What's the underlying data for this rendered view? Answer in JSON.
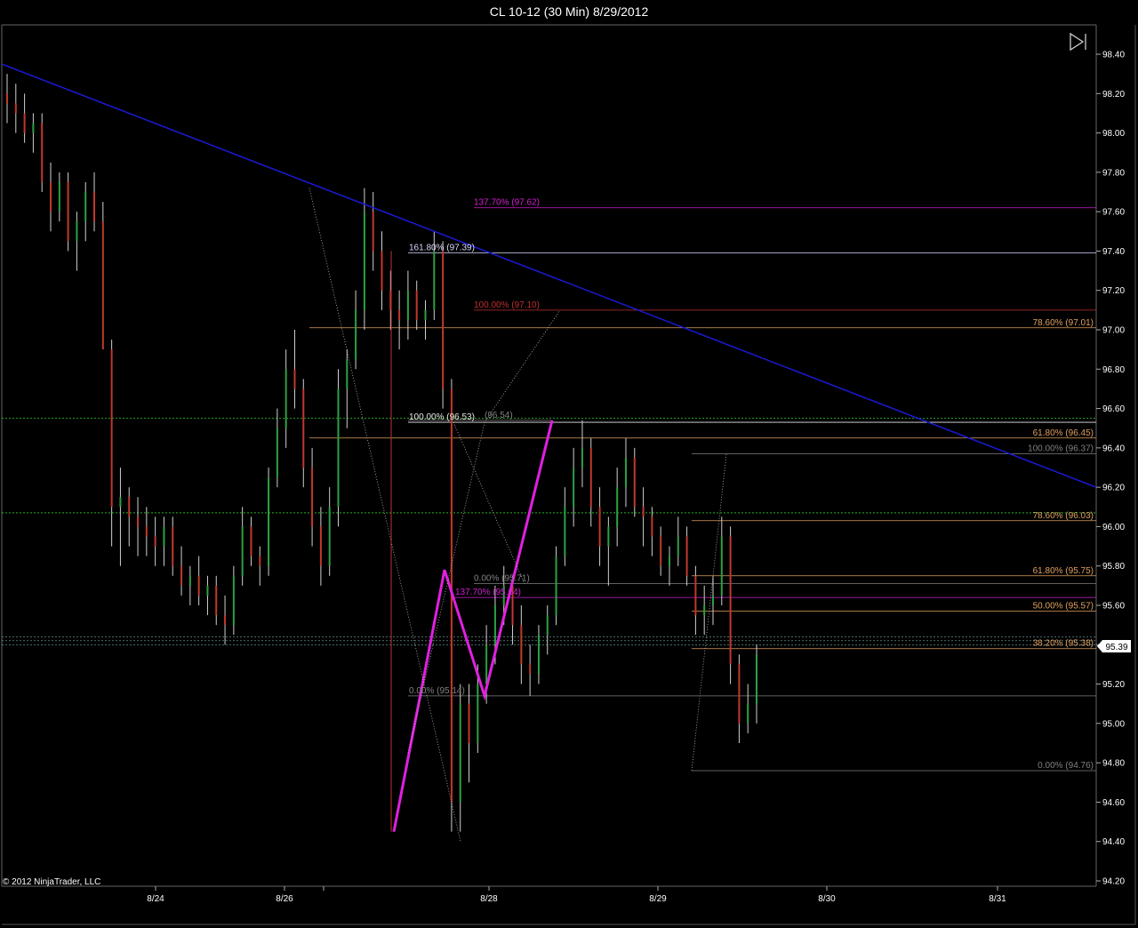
{
  "window": {
    "title": "CL 10-12 (30 Min)  8/29/2012"
  },
  "copyright": "© 2012 NinjaTrader, LLC",
  "price_marker": "95.39",
  "controls": {
    "jump_to_end_icon": "skip-to-end-icon"
  },
  "colors": {
    "background": "#000000",
    "up_bar": "#2ea043",
    "down_bar": "#c0392b",
    "neutral_bar": "#cccccc",
    "trendline": "#1a1ad6",
    "pattern": "#e020e0",
    "green_dashed": "#2ed02e"
  },
  "chart_data": {
    "type": "ohlc",
    "instrument": "CL 10-12",
    "interval": "30 Min",
    "ylim": [
      94.2,
      98.5
    ],
    "yticks": [
      "98.40",
      "98.20",
      "98.00",
      "97.80",
      "97.60",
      "97.40",
      "97.20",
      "97.00",
      "96.80",
      "96.60",
      "96.40",
      "96.20",
      "96.00",
      "95.80",
      "95.60",
      "95.40",
      "95.20",
      "95.00",
      "94.80",
      "94.60",
      "94.40",
      "94.20"
    ],
    "xticks": [
      "8/24",
      "8/26",
      "8/28",
      "8/29",
      "8/30",
      "8/31"
    ],
    "last_price": 95.39,
    "fib_levels": [
      {
        "label": "137.70% (97.62)",
        "price": 97.62,
        "color": "#d020d0"
      },
      {
        "label": "161.80% (97.39)",
        "price": 97.39,
        "color": "#d8d8ff"
      },
      {
        "label": "100.00% (97.10)",
        "price": 97.1,
        "color": "#c0302c"
      },
      {
        "label": "78.60% (97.01)",
        "price": 97.01,
        "color": "#e0a060"
      },
      {
        "label": "100.00% (96.53)",
        "price": 96.53,
        "color": "#e8e8e8"
      },
      {
        "label": "(96.54)",
        "price": 96.54,
        "color": "#808080"
      },
      {
        "label": "61.80% (96.45)",
        "price": 96.45,
        "color": "#e0a060"
      },
      {
        "label": "100.00% (96.37)",
        "price": 96.37,
        "color": "#808080"
      },
      {
        "label": "78.60% (96.03)",
        "price": 96.03,
        "color": "#e0a060"
      },
      {
        "label": "61.80% (95.75)",
        "price": 95.75,
        "color": "#e0a060"
      },
      {
        "label": "0.00% (95.71)",
        "price": 95.71,
        "color": "#808080"
      },
      {
        "label": "137.70% (95.64)",
        "price": 95.64,
        "color": "#d020d0"
      },
      {
        "label": "50.00% (95.57)",
        "price": 95.57,
        "color": "#e0a060"
      },
      {
        "label": "38.20% (95.38)",
        "price": 95.38,
        "color": "#e0a060"
      },
      {
        "label": "0.00% (95.14)",
        "price": 95.14,
        "color": "#808080"
      },
      {
        "label": "0.00% (94.76)",
        "price": 94.76,
        "color": "#808080"
      }
    ],
    "ohlc": [
      [
        98.2,
        98.3,
        98.05,
        98.15
      ],
      [
        98.15,
        98.25,
        98.0,
        98.1
      ],
      [
        98.1,
        98.2,
        97.95,
        98.0
      ],
      [
        98.0,
        98.1,
        97.9,
        98.05
      ],
      [
        98.05,
        98.1,
        97.7,
        97.75
      ],
      [
        97.75,
        97.85,
        97.5,
        97.6
      ],
      [
        97.6,
        97.8,
        97.55,
        97.75
      ],
      [
        97.75,
        97.8,
        97.4,
        97.45
      ],
      [
        97.45,
        97.6,
        97.3,
        97.55
      ],
      [
        97.55,
        97.75,
        97.45,
        97.7
      ],
      [
        97.7,
        97.8,
        97.5,
        97.55
      ],
      [
        97.55,
        97.65,
        97.2,
        96.9
      ],
      [
        96.9,
        96.95,
        95.9,
        96.1
      ],
      [
        96.1,
        96.3,
        95.8,
        96.15
      ],
      [
        96.15,
        96.2,
        95.9,
        96.05
      ],
      [
        96.05,
        96.15,
        95.85,
        96.0
      ],
      [
        96.0,
        96.1,
        95.85,
        95.95
      ],
      [
        95.95,
        96.05,
        95.8,
        95.9
      ],
      [
        95.9,
        96.05,
        95.8,
        96.0
      ],
      [
        96.0,
        96.05,
        95.75,
        95.8
      ],
      [
        95.8,
        95.9,
        95.65,
        95.7
      ],
      [
        95.7,
        95.8,
        95.6,
        95.75
      ],
      [
        95.75,
        95.85,
        95.6,
        95.65
      ],
      [
        95.65,
        95.75,
        95.55,
        95.7
      ],
      [
        95.7,
        95.75,
        95.5,
        95.55
      ],
      [
        95.55,
        95.65,
        95.4,
        95.5
      ],
      [
        95.5,
        95.8,
        95.45,
        95.75
      ],
      [
        95.75,
        96.1,
        95.7,
        96.0
      ],
      [
        96.0,
        96.05,
        95.8,
        95.85
      ],
      [
        95.85,
        95.9,
        95.7,
        95.8
      ],
      [
        95.8,
        96.3,
        95.75,
        96.25
      ],
      [
        96.25,
        96.6,
        96.2,
        96.5
      ],
      [
        96.5,
        96.9,
        96.4,
        96.8
      ],
      [
        96.8,
        97.0,
        96.6,
        96.7
      ],
      [
        96.7,
        96.75,
        96.2,
        96.3
      ],
      [
        96.3,
        96.4,
        95.9,
        96.0
      ],
      [
        96.0,
        96.1,
        95.7,
        95.8
      ],
      [
        95.8,
        96.2,
        95.75,
        96.1
      ],
      [
        96.1,
        96.8,
        96.0,
        96.7
      ],
      [
        96.7,
        96.9,
        96.5,
        96.85
      ],
      [
        96.85,
        97.2,
        96.8,
        97.1
      ],
      [
        97.1,
        97.72,
        97.0,
        97.6
      ],
      [
        97.6,
        97.7,
        97.3,
        97.4
      ],
      [
        97.4,
        97.5,
        97.1,
        97.2
      ],
      [
        97.2,
        97.3,
        97.0,
        97.1
      ],
      [
        97.1,
        97.2,
        96.9,
        97.05
      ],
      [
        97.05,
        97.3,
        96.95,
        97.2
      ],
      [
        97.2,
        97.25,
        97.0,
        97.05
      ],
      [
        97.05,
        97.15,
        96.95,
        97.1
      ],
      [
        97.1,
        97.5,
        97.05,
        97.4
      ],
      [
        97.4,
        97.45,
        96.6,
        96.7
      ],
      [
        96.7,
        96.75,
        94.45,
        94.6
      ],
      [
        94.6,
        95.2,
        94.45,
        95.1
      ],
      [
        95.1,
        95.2,
        94.7,
        94.9
      ],
      [
        94.9,
        95.3,
        94.85,
        95.2
      ],
      [
        95.2,
        95.5,
        95.1,
        95.4
      ],
      [
        95.4,
        95.7,
        95.3,
        95.6
      ],
      [
        95.6,
        95.8,
        95.5,
        95.7
      ],
      [
        95.7,
        95.75,
        95.4,
        95.5
      ],
      [
        95.5,
        95.6,
        95.2,
        95.3
      ],
      [
        95.3,
        95.4,
        95.14,
        95.25
      ],
      [
        95.25,
        95.5,
        95.2,
        95.45
      ],
      [
        95.45,
        95.6,
        95.35,
        95.55
      ],
      [
        95.55,
        95.9,
        95.5,
        95.85
      ],
      [
        95.85,
        96.2,
        95.8,
        96.1
      ],
      [
        96.1,
        96.4,
        96.0,
        96.3
      ],
      [
        96.3,
        96.54,
        96.2,
        96.4
      ],
      [
        96.4,
        96.45,
        96.0,
        96.1
      ],
      [
        96.1,
        96.2,
        95.8,
        95.9
      ],
      [
        95.9,
        96.05,
        95.7,
        96.0
      ],
      [
        96.0,
        96.3,
        95.9,
        96.2
      ],
      [
        96.2,
        96.45,
        96.1,
        96.35
      ],
      [
        96.35,
        96.4,
        96.05,
        96.1
      ],
      [
        96.1,
        96.2,
        95.9,
        96.05
      ],
      [
        96.05,
        96.1,
        95.85,
        95.95
      ],
      [
        95.95,
        96.0,
        95.75,
        95.8
      ],
      [
        95.8,
        95.9,
        95.7,
        95.85
      ],
      [
        95.85,
        96.05,
        95.8,
        95.95
      ],
      [
        95.95,
        96.0,
        95.7,
        95.75
      ],
      [
        95.75,
        95.8,
        95.45,
        95.55
      ],
      [
        95.55,
        95.7,
        95.45,
        95.6
      ],
      [
        95.6,
        95.75,
        95.5,
        95.65
      ],
      [
        95.65,
        96.05,
        95.6,
        95.95
      ],
      [
        95.95,
        96.0,
        95.2,
        95.3
      ],
      [
        95.3,
        95.35,
        94.9,
        95.0
      ],
      [
        95.0,
        95.2,
        94.95,
        95.1
      ],
      [
        95.1,
        95.4,
        95.0,
        95.35
      ]
    ]
  }
}
